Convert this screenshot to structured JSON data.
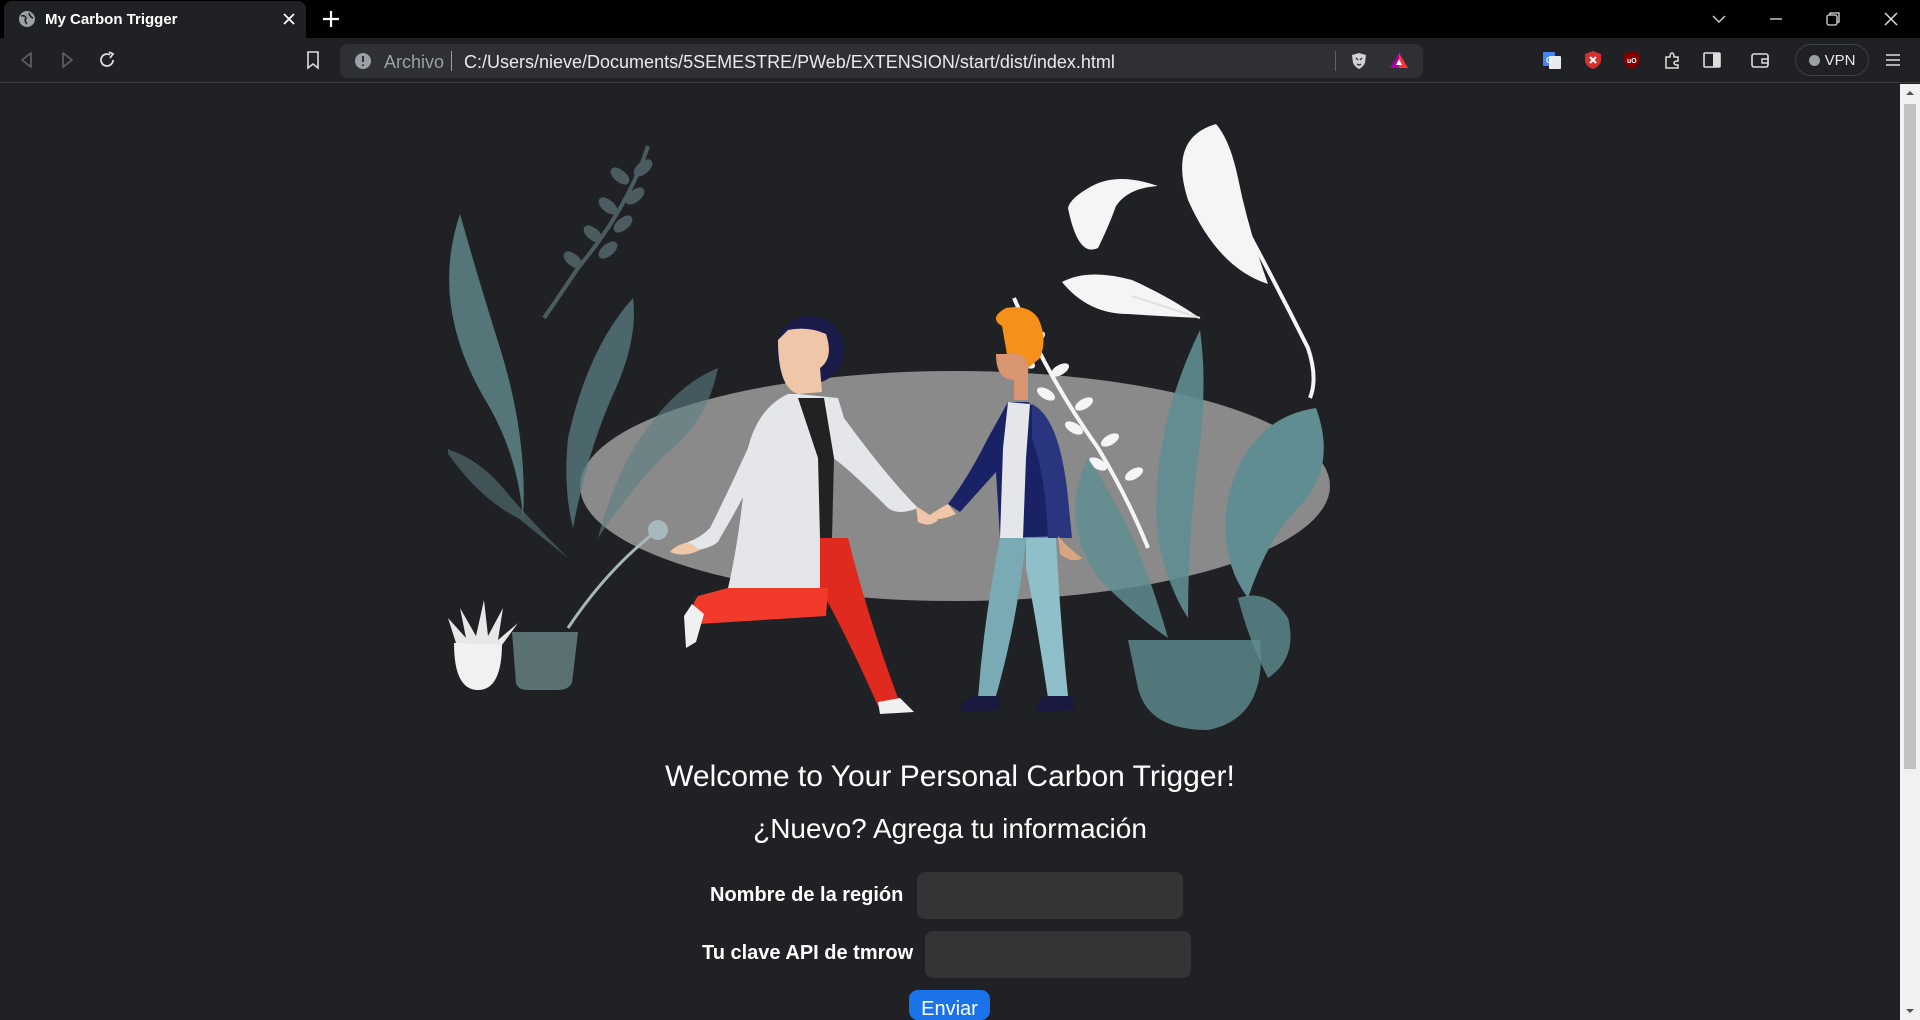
{
  "browser": {
    "tab_title": "My Carbon Trigger",
    "omnibox": {
      "scheme_label": "Archivo",
      "url": "C:/Users/nieve/Documents/5SEMESTRE/PWeb/EXTENSION/start/dist/index.html"
    },
    "vpn_label": "VPN",
    "icons": [
      "globe-icon",
      "close-icon",
      "plus-icon",
      "chevron-down-icon",
      "minimize-icon",
      "restore-icon",
      "back-icon",
      "forward-icon",
      "reload-icon",
      "bookmark-icon",
      "info-icon",
      "brave-shield-icon",
      "brave-rewards-icon",
      "translate-icon",
      "blocker-icon",
      "ublock-icon",
      "puzzle-icon",
      "sidebar-icon",
      "wallet-icon"
    ]
  },
  "page": {
    "title": "Welcome to Your Personal Carbon Trigger!",
    "subtitle": "¿Nuevo? Agrega tu información",
    "form": {
      "region_label": "Nombre de la región",
      "region_value": "",
      "api_label": "Tu clave API de tmrow",
      "api_value": "",
      "submit_label": "Enviar"
    }
  },
  "colors": {
    "page_bg": "#202124",
    "button_blue": "#1a73e8",
    "input_bg": "#333436"
  }
}
